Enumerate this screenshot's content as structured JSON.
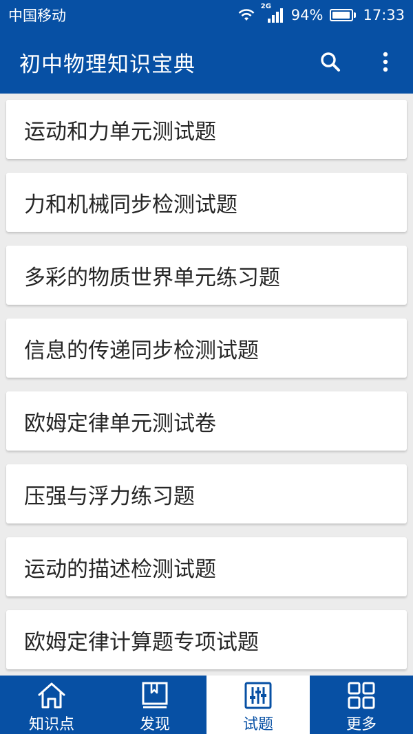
{
  "status_bar": {
    "carrier": "中国移动",
    "network": "2G",
    "battery": "94%",
    "battery_level": 0.94,
    "time": "17:33"
  },
  "app_bar": {
    "title": "初中物理知识宝典",
    "search_icon": "search-icon",
    "more_icon": "more-vert-icon"
  },
  "list": {
    "items": [
      {
        "label": "运动和力单元测试题"
      },
      {
        "label": "力和机械同步检测试题"
      },
      {
        "label": "多彩的物质世界单元练习题"
      },
      {
        "label": "信息的传递同步检测试题"
      },
      {
        "label": "欧姆定律单元测试卷"
      },
      {
        "label": "压强与浮力练习题"
      },
      {
        "label": "运动的描述检测试题"
      },
      {
        "label": "欧姆定律计算题专项试题"
      }
    ]
  },
  "bottom_nav": {
    "items": [
      {
        "label": "知识点",
        "icon": "home-icon",
        "active": false
      },
      {
        "label": "发现",
        "icon": "book-icon",
        "active": false
      },
      {
        "label": "试题",
        "icon": "sliders-icon",
        "active": true
      },
      {
        "label": "更多",
        "icon": "grid-icon",
        "active": false
      }
    ]
  },
  "colors": {
    "primary": "#0750a4",
    "background": "#ececec",
    "card": "#ffffff",
    "text": "#262626"
  }
}
